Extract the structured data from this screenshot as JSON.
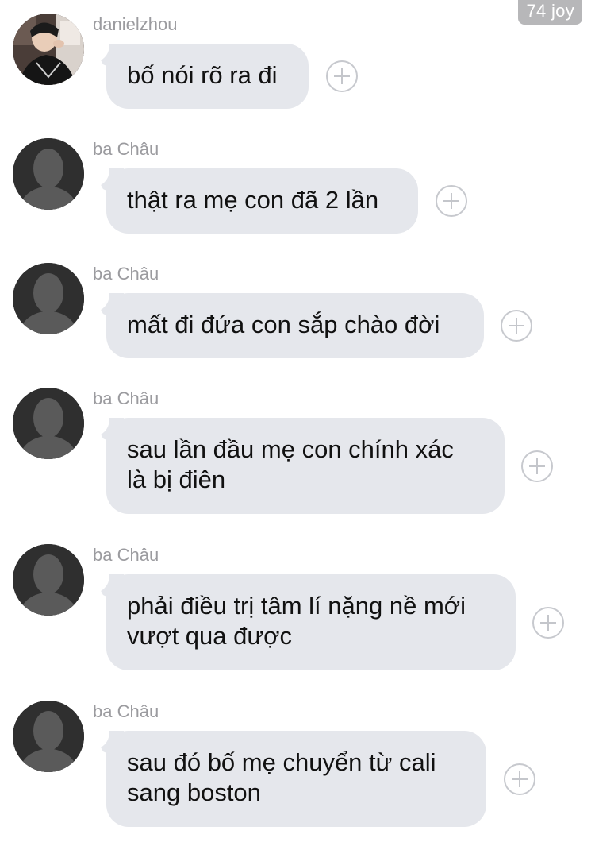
{
  "watermark": "74 joy",
  "messages": [
    {
      "sender": "danielzhou",
      "avatar": "photo-avatar",
      "text": "bố nói rõ ra đi"
    },
    {
      "sender": "ba Châu",
      "avatar": "default-avatar",
      "text": "thật ra mẹ con đã 2 lần"
    },
    {
      "sender": "ba Châu",
      "avatar": "default-avatar",
      "text": "mất đi đứa con sắp chào đời"
    },
    {
      "sender": "ba Châu",
      "avatar": "default-avatar",
      "text": "sau lần đầu mẹ con chính xác\nlà bị điên"
    },
    {
      "sender": "ba Châu",
      "avatar": "default-avatar",
      "text": "phải điều trị tâm lí nặng nề mới\nvượt qua được"
    },
    {
      "sender": "ba Châu",
      "avatar": "default-avatar",
      "text": "sau đó bố mẹ chuyển từ cali\nsang boston"
    }
  ],
  "colors": {
    "bubble": "#e5e7ec",
    "sender": "#9b9b9f",
    "text": "#111111",
    "default_avatar_bg": "#2f2f2f",
    "default_avatar_fg": "#5a5a5a"
  },
  "icons": {
    "add": "plus-circle-icon"
  }
}
